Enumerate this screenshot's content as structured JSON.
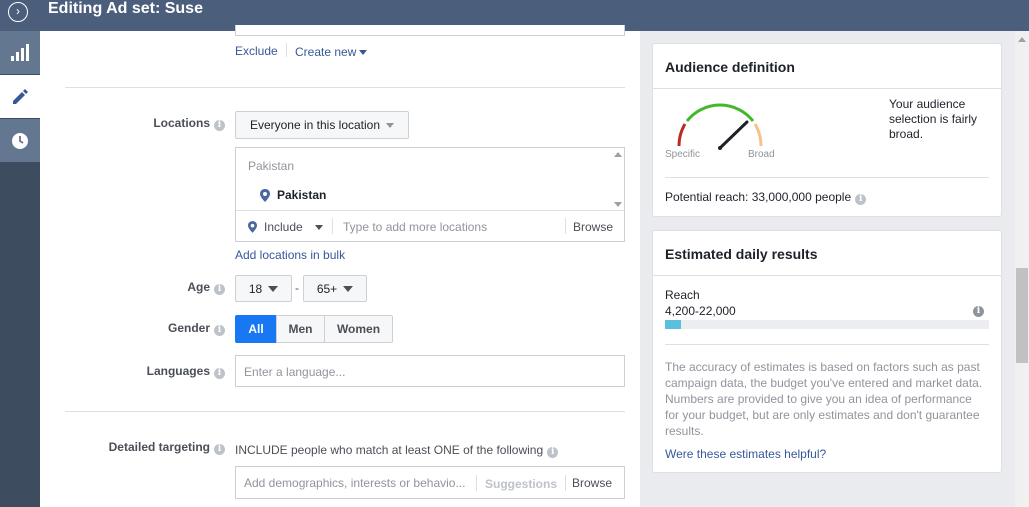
{
  "header": {
    "title": "Editing Ad set: Suse",
    "toggle_icon": "chevron-right-circle-icon"
  },
  "rail": {
    "items": [
      {
        "icon": "bar-chart-icon"
      },
      {
        "icon": "pencil-icon"
      },
      {
        "icon": "clock-icon"
      }
    ]
  },
  "custom_audience": {
    "exclude_label": "Exclude",
    "create_new_label": "Create new"
  },
  "locations": {
    "label": "Locations",
    "dropdown_value": "Everyone in this location",
    "group_heading": "Pakistan",
    "selected": "Pakistan",
    "include_label": "Include",
    "search_placeholder": "Type to add more locations",
    "browse_label": "Browse",
    "bulk_link": "Add locations in bulk"
  },
  "age": {
    "label": "Age",
    "min": "18",
    "separator": "-",
    "max": "65+"
  },
  "gender": {
    "label": "Gender",
    "options": [
      "All",
      "Men",
      "Women"
    ],
    "selected": "All"
  },
  "languages": {
    "label": "Languages",
    "placeholder": "Enter a language..."
  },
  "detailed_targeting": {
    "label": "Detailed targeting",
    "description": "INCLUDE people who match at least ONE of the following",
    "placeholder": "Add demographics, interests or behavio...",
    "suggestions_label": "Suggestions",
    "browse_label": "Browse"
  },
  "audience_definition": {
    "title": "Audience definition",
    "description": "Your audience selection is fairly broad.",
    "gauge_specific": "Specific",
    "gauge_broad": "Broad",
    "gauge_level": 0.72,
    "potential_reach": "Potential reach: 33,000,000 people"
  },
  "estimated_results": {
    "title": "Estimated daily results",
    "reach_label": "Reach",
    "reach_value": "4,200-22,000",
    "reach_fill": 0.05,
    "disclaimer": "The accuracy of estimates is based on factors such as past campaign data, the budget you've entered and market data. Numbers are provided to give you an idea of performance for your budget, but are only estimates and don't guarantee results.",
    "helpful_link": "Were these estimates helpful?"
  },
  "colors": {
    "header_bg": "#4b5f7d",
    "link": "#365899",
    "primary": "#1877f2",
    "reach_bar": "#5bc0de"
  }
}
